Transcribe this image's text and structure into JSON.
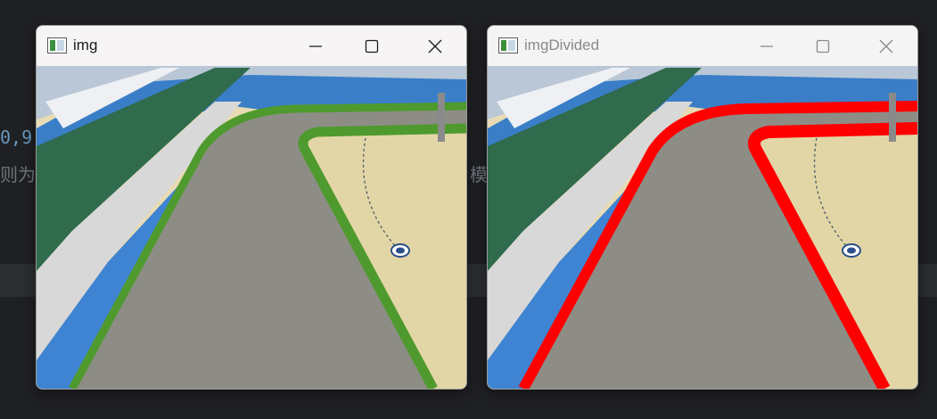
{
  "background": {
    "code_fragment": "0,9",
    "squiggle": "〰",
    "text_left": "则为",
    "text_right": "模"
  },
  "windows": [
    {
      "title": "img",
      "state": "active",
      "lane_color": "#4f9a2e"
    },
    {
      "title": "imgDivided",
      "state": "inactive",
      "lane_color": "#ff0000"
    }
  ],
  "icons": {
    "app": "opencv-window-icon",
    "minimize": "minimize-icon",
    "maximize": "maximize-icon",
    "close": "close-icon"
  }
}
